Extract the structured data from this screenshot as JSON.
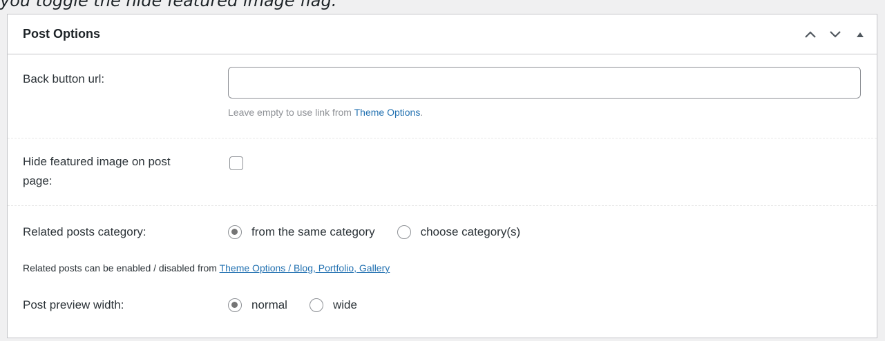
{
  "caption": "you toggle the hide featured image flag.",
  "panel": {
    "title": "Post Options",
    "controls": [
      "move-up",
      "move-down",
      "toggle-panel"
    ]
  },
  "back_button": {
    "label": "Back button url:",
    "value": "",
    "placeholder": "",
    "hint_prefix": "Leave empty to use link from ",
    "hint_link": "Theme Options",
    "hint_suffix": "."
  },
  "hide_featured": {
    "label_line1": "Hide featured image on post",
    "label_line2": "page:",
    "checked": false
  },
  "related": {
    "label": "Related posts category:",
    "options": [
      {
        "label": "from the same category",
        "checked": true
      },
      {
        "label": "choose category(s)",
        "checked": false
      }
    ],
    "note_prefix": "Related posts can be enabled / disabled from ",
    "note_link": "Theme Options / Blog, Portfolio, Gallery"
  },
  "preview_width": {
    "label": "Post preview width:",
    "options": [
      {
        "label": "normal",
        "checked": true
      },
      {
        "label": "wide",
        "checked": false
      }
    ]
  }
}
